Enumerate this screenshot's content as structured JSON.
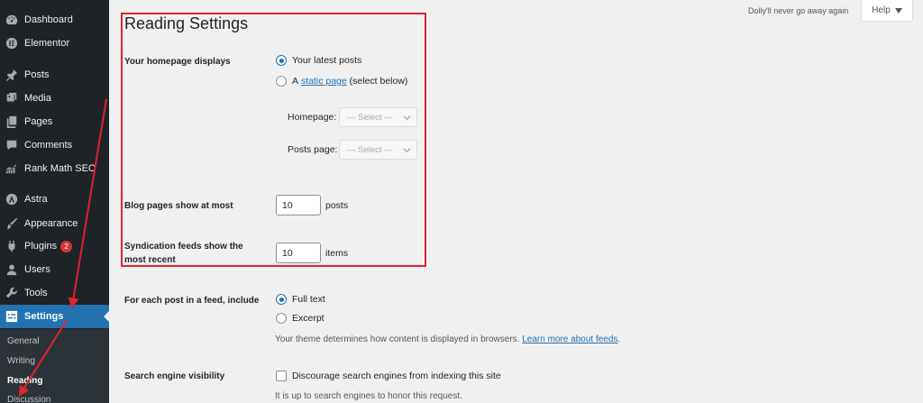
{
  "sidebar": {
    "items": [
      {
        "label": "Dashboard",
        "icon": "dashboard-icon"
      },
      {
        "label": "Elementor",
        "icon": "elementor-icon"
      },
      {
        "label": "Posts",
        "icon": "pin-icon"
      },
      {
        "label": "Media",
        "icon": "media-icon"
      },
      {
        "label": "Pages",
        "icon": "pages-icon"
      },
      {
        "label": "Comments",
        "icon": "comment-icon"
      },
      {
        "label": "Rank Math SEO",
        "icon": "chart-icon"
      },
      {
        "label": "Astra",
        "icon": "astra-icon"
      },
      {
        "label": "Appearance",
        "icon": "brush-icon"
      },
      {
        "label": "Plugins",
        "icon": "plug-icon",
        "badge": "2"
      },
      {
        "label": "Users",
        "icon": "user-icon"
      },
      {
        "label": "Tools",
        "icon": "wrench-icon"
      },
      {
        "label": "Settings",
        "icon": "settings-icon",
        "active": true
      }
    ],
    "submenu": [
      {
        "label": "General"
      },
      {
        "label": "Writing"
      },
      {
        "label": "Reading",
        "current": true
      },
      {
        "label": "Discussion"
      }
    ],
    "colors": {
      "bg": "#1d2327",
      "active": "#2271b1",
      "submenu_bg": "#2c3338",
      "badge": "#d63638"
    }
  },
  "topbar": {
    "dolly_text": "Dolly'll never go away again",
    "help_label": "Help"
  },
  "page": {
    "title": "Reading Settings",
    "homepage_displays": {
      "label": "Your homepage displays",
      "option_latest": "Your latest posts",
      "option_static_prefix": "A",
      "option_static_link": "static page",
      "option_static_suffix": "(select below)",
      "selected": "latest",
      "homepage_label": "Homepage:",
      "homepage_select": "— Select —",
      "posts_page_label": "Posts page:",
      "posts_page_select": "— Select —"
    },
    "blog_pages": {
      "label": "Blog pages show at most",
      "value": "10",
      "unit": "posts"
    },
    "syndication": {
      "label_line1": "Syndication feeds show the",
      "label_line2": "most recent",
      "value": "10",
      "unit": "items"
    },
    "feed_content": {
      "label": "For each post in a feed, include",
      "option_full": "Full text",
      "option_excerpt": "Excerpt",
      "selected": "full",
      "desc_prefix": "Your theme determines how content is displayed in browsers.",
      "desc_link": "Learn more about feeds"
    },
    "search_visibility": {
      "label": "Search engine visibility",
      "checkbox_label": "Discourage search engines from indexing this site",
      "checked": false,
      "desc": "It is up to search engines to honor this request."
    }
  },
  "annotation": {
    "highlight_color": "#e0232e"
  }
}
